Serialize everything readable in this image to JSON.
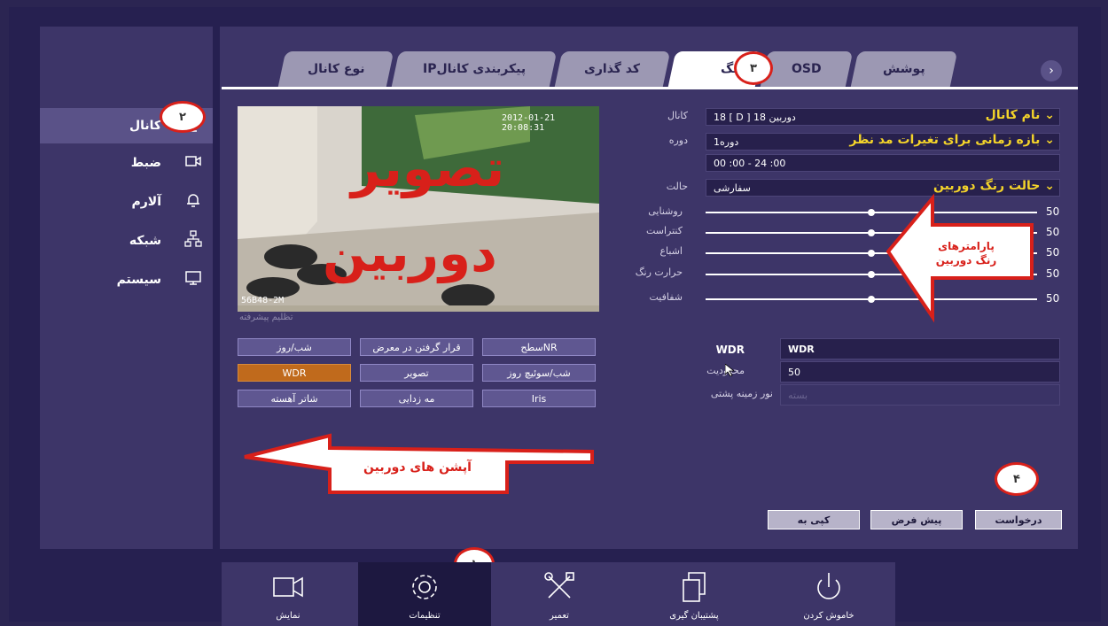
{
  "sidebar": {
    "items": [
      {
        "label": "کانال",
        "icon": "camera-icon",
        "badge": "۲"
      },
      {
        "label": "ضبط",
        "icon": "video-record-icon"
      },
      {
        "label": "آلارم",
        "icon": "bell-icon"
      },
      {
        "label": "شبکه",
        "icon": "network-icon"
      },
      {
        "label": "سیستم",
        "icon": "monitor-icon"
      }
    ]
  },
  "tabs": [
    {
      "label": "نوع کانال"
    },
    {
      "label": "IPپیکربندی کانال"
    },
    {
      "label": "کد گذاری"
    },
    {
      "label": "رنگ",
      "badge": "۳"
    },
    {
      "label": "OSD"
    },
    {
      "label": "پوشش"
    }
  ],
  "preview": {
    "big_text_1": "تصویر",
    "big_text_2": "دوربین",
    "timestamp": "2012-01-21 20:08:31",
    "cam_id": "56B48-2M",
    "advanced_label": "تظلیم پیشرفته"
  },
  "form": {
    "channel": {
      "label": "کانال",
      "value": "18 [ D ] 18 دوربین",
      "annotation": "نام کانال"
    },
    "period": {
      "label": "دوره",
      "value": "1دوره",
      "time": "00 :00  - 24 :00",
      "annotation": "بازه زمانی برای تغیرات مد نظر"
    },
    "mode": {
      "label": "حالت",
      "value": "سفارشی",
      "annotation": "حالت رنگ دوربین"
    },
    "sliders": [
      {
        "label": "روشنایی",
        "value": "50"
      },
      {
        "label": "کنتراست",
        "value": "50"
      },
      {
        "label": "اشباع",
        "value": "50"
      },
      {
        "label": "حرارت رنگ",
        "value": "50"
      },
      {
        "label": "شفافیت",
        "value": "50"
      }
    ],
    "slider_callout": [
      "پارامترهای",
      "رنگ دوربین"
    ],
    "wdr": {
      "label": "WDR",
      "value": "WDR"
    },
    "limit": {
      "label": "محدودیت",
      "value": "50"
    },
    "backlight": {
      "label": "نور زمینه پشتی",
      "value": "بسته"
    }
  },
  "options": [
    [
      "شب/روز",
      "قرار گرفتن در معرض",
      "سطحNR"
    ],
    [
      "WDR",
      "تصویر",
      "شب/سوئیچ روز"
    ],
    [
      "شاتر آهسته",
      "مه زدایی",
      "Iris"
    ]
  ],
  "options_callout": "آپشن های دوربین",
  "actions": {
    "copy": "کپی به",
    "default": "پیش فرض",
    "apply": "درخواست",
    "badge": "۴"
  },
  "bottom": [
    {
      "label": "نمایش",
      "icon": "display-icon"
    },
    {
      "label": "تنظیمات",
      "icon": "gear-icon",
      "badge": "۱"
    },
    {
      "label": "تعمیر",
      "icon": "tools-icon"
    },
    {
      "label": "پشتیبان گیری",
      "icon": "copy-icon"
    },
    {
      "label": "خاموش کردن",
      "icon": "power-icon"
    }
  ],
  "colors": {
    "accent": "#c06a1c",
    "callout": "#d8201a",
    "panel": "#3d3568"
  }
}
